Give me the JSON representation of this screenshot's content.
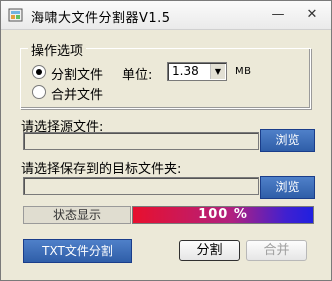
{
  "window": {
    "title": "海啸大文件分割器V1.5",
    "minimize_glyph": "—",
    "close_glyph": "✕"
  },
  "options": {
    "group_label": "操作选项",
    "split_label": "分割文件",
    "merge_label": "合并文件",
    "selected": "split",
    "unit_label": "单位:",
    "size_value": "1.38",
    "size_unit": "MB"
  },
  "source": {
    "label": "请选择源文件:",
    "value": "",
    "browse_label": "浏览"
  },
  "target": {
    "label": "请选择保存到的目标文件夹:",
    "value": "",
    "browse_label": "浏览"
  },
  "status": {
    "label": "状态显示",
    "progress_percent": 100,
    "progress_text": "100 %"
  },
  "buttons": {
    "txt_split_label": "TXT文件分割",
    "split_label": "分割",
    "merge_label": "合并",
    "merge_enabled": false
  },
  "icons": {
    "app": "app-icon",
    "dropdown": "chevron-down-icon"
  },
  "colors": {
    "accent_button": "#3a68b4",
    "progress_start": "#e8102e",
    "progress_end": "#2020e0"
  }
}
